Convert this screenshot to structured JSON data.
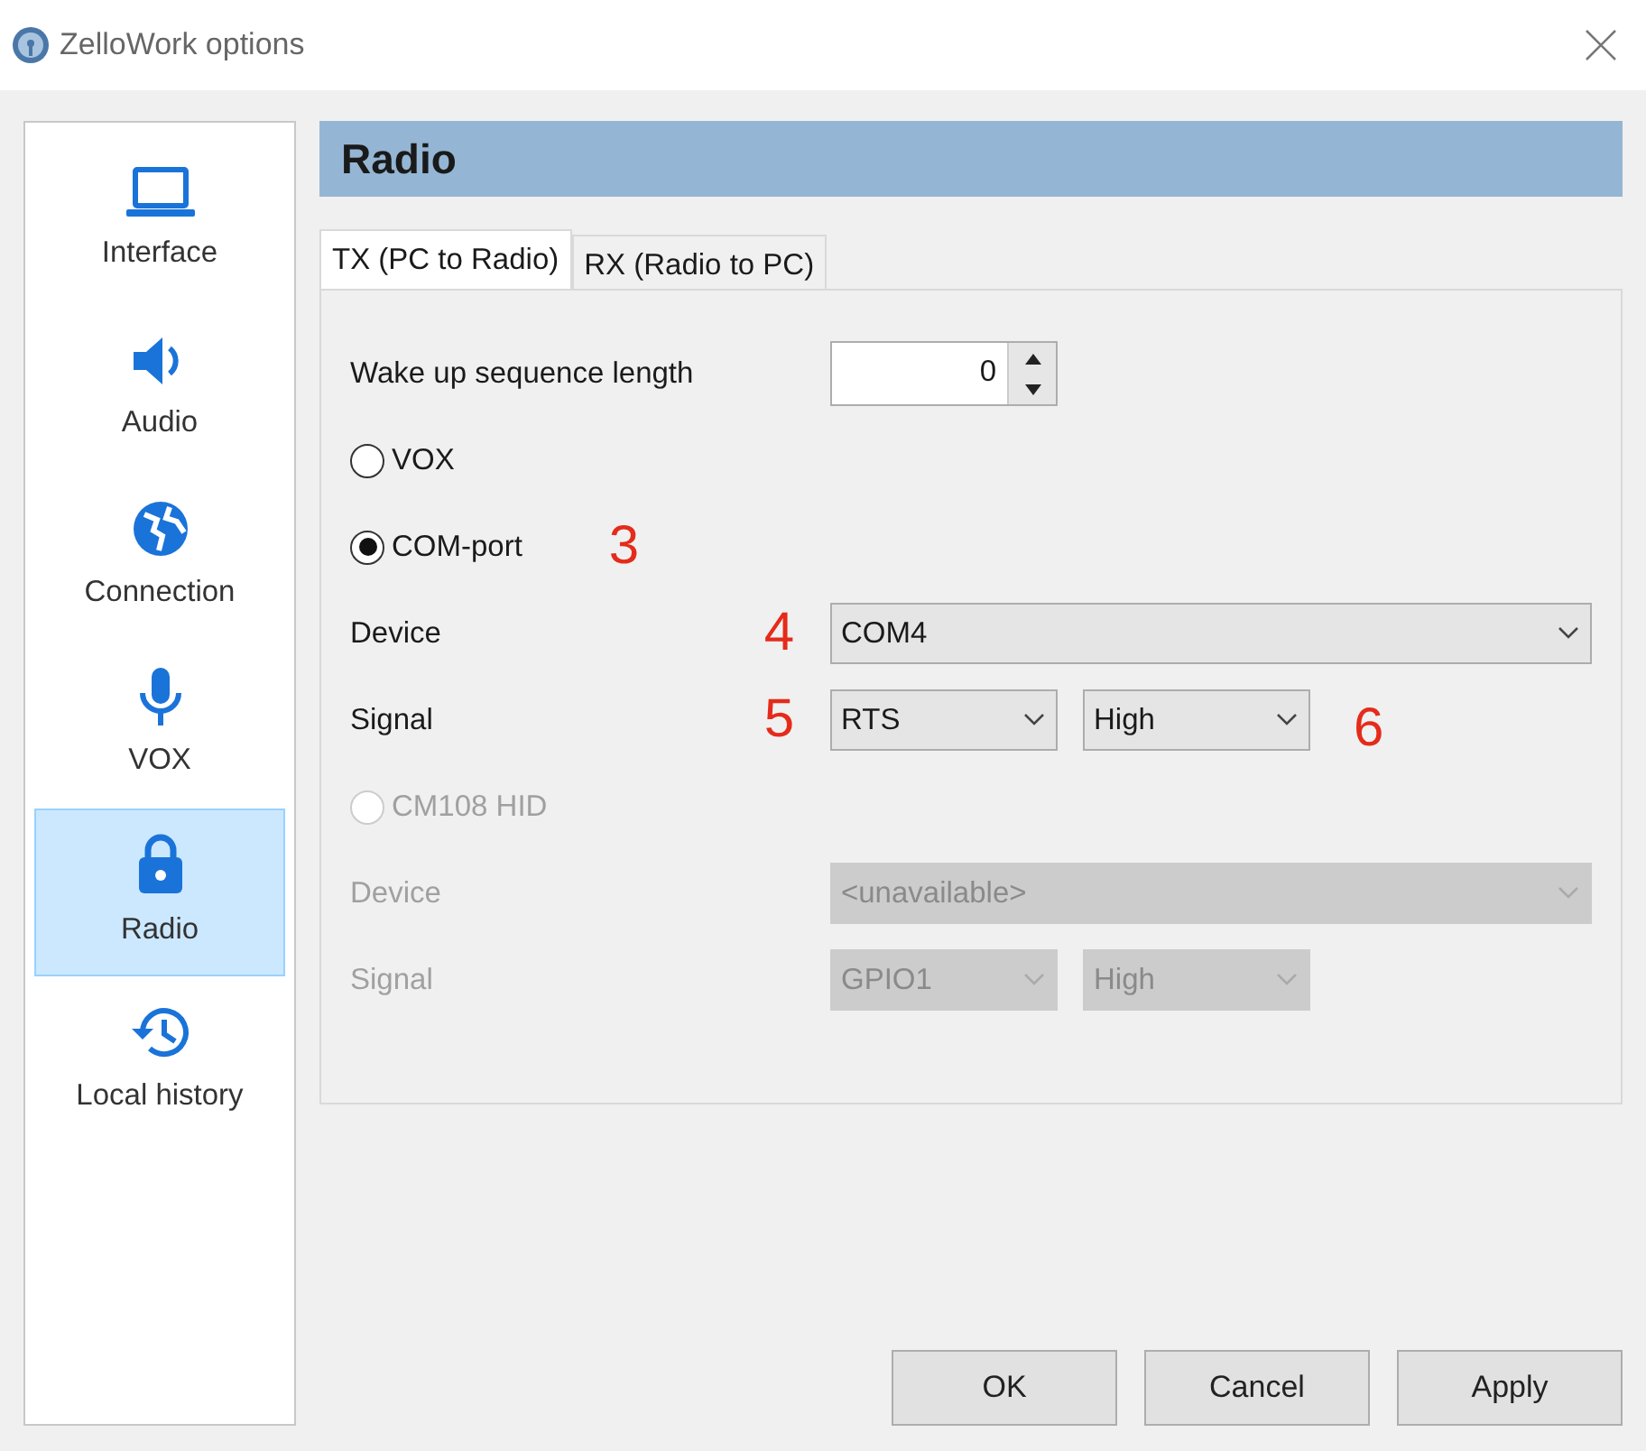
{
  "window": {
    "title": "ZelloWork options"
  },
  "sidebar": {
    "items": [
      {
        "label": "Interface",
        "selected": false
      },
      {
        "label": "Audio",
        "selected": false
      },
      {
        "label": "Connection",
        "selected": false
      },
      {
        "label": "VOX",
        "selected": false
      },
      {
        "label": "Radio",
        "selected": true
      },
      {
        "label": "Local history",
        "selected": false
      }
    ]
  },
  "section_title": "Radio",
  "tabs": [
    {
      "label": "TX (PC to Radio)",
      "selected": true
    },
    {
      "label": "RX (Radio to PC)",
      "selected": false
    }
  ],
  "rows": [
    {
      "kind": "spin",
      "label": "Wake up sequence length",
      "value": "0"
    },
    {
      "kind": "radio",
      "label": "VOX",
      "checked": false,
      "disabled": false
    },
    {
      "kind": "radio",
      "label": "COM-port",
      "checked": true,
      "disabled": false,
      "annotation": "3"
    },
    {
      "kind": "select",
      "label": "Device",
      "disabled": false,
      "annotation": "4",
      "selects": [
        "COM4"
      ]
    },
    {
      "kind": "select",
      "label": "Signal",
      "disabled": false,
      "annotation": "5",
      "selects": [
        "RTS",
        "High"
      ],
      "trailing_annotation": "6"
    },
    {
      "kind": "radio",
      "label": "CM108 HID",
      "checked": false,
      "disabled": true
    },
    {
      "kind": "select",
      "label": "Device",
      "disabled": true,
      "selects": [
        "<unavailable>"
      ]
    },
    {
      "kind": "select",
      "label": "Signal",
      "disabled": true,
      "selects": [
        "GPIO1",
        "High"
      ]
    }
  ],
  "buttons": [
    "OK",
    "Cancel",
    "Apply"
  ]
}
